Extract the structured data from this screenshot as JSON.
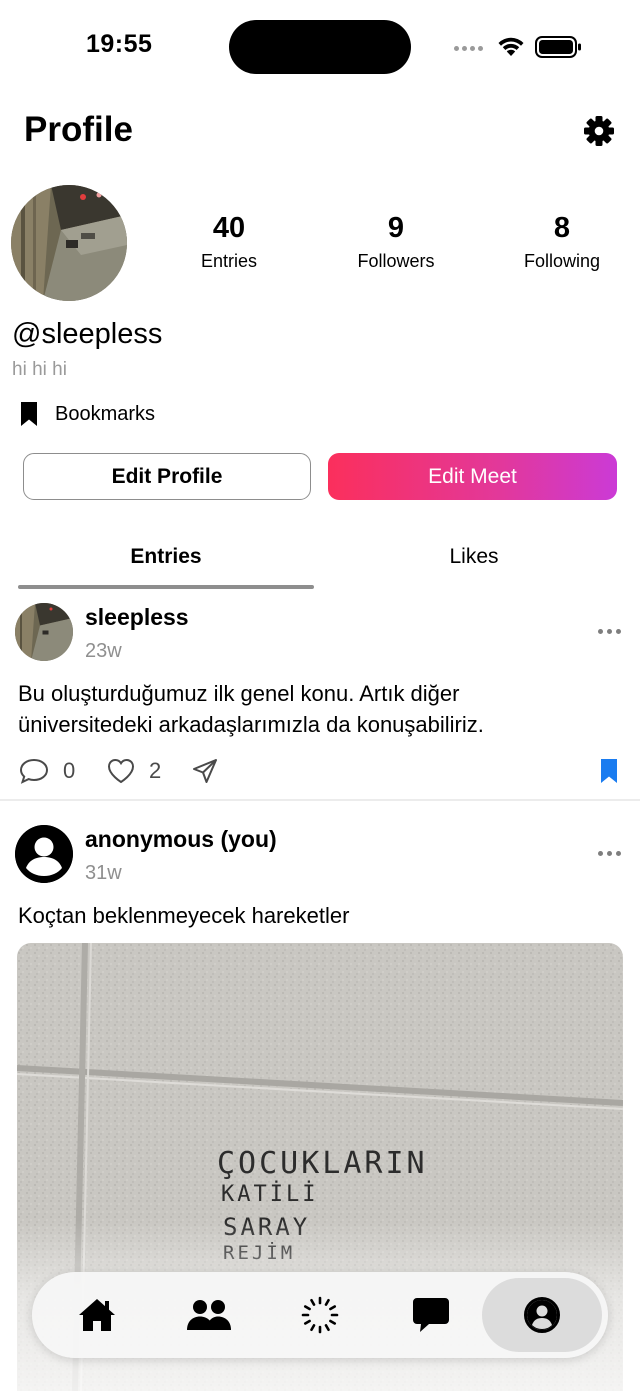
{
  "status_bar": {
    "time": "19:55"
  },
  "header": {
    "title": "Profile"
  },
  "profile": {
    "stats": [
      {
        "value": "40",
        "label": "Entries"
      },
      {
        "value": "9",
        "label": "Followers"
      },
      {
        "value": "8",
        "label": "Following"
      }
    ],
    "handle": "@sleepless",
    "bio": "hi hi hi",
    "bookmarks_label": "Bookmarks",
    "edit_profile_label": "Edit Profile",
    "edit_meet_label": "Edit Meet"
  },
  "tabs": [
    {
      "label": "Entries",
      "active": true
    },
    {
      "label": "Likes",
      "active": false
    }
  ],
  "posts": [
    {
      "username": "sleepless",
      "time": "23w",
      "text_line1": "Bu oluşturduğumuz ilk genel konu. Artık diğer",
      "text_line2": "üniversitedeki arkadaşlarımızla da konuşabiliriz.",
      "comments": "0",
      "likes": "2",
      "bookmarked": true
    },
    {
      "username": "anonymous (you)",
      "time": "31w",
      "text": "Koçtan beklenmeyecek hareketler",
      "image_writing": [
        "ÇOCUKLARIN",
        "KATİLİ",
        "SARAY",
        "REJİM"
      ]
    }
  ],
  "tab_bar": {
    "items": [
      "house-icon",
      "people-icon",
      "spinner-icon",
      "chat-bubble-icon",
      "person-circle-icon"
    ],
    "selected": "person-circle-icon"
  },
  "colors": {
    "accent_blue": "#1a7cf0",
    "meet_gradient_start": "#fb2f5c",
    "meet_gradient_end": "#cb3ad6"
  }
}
